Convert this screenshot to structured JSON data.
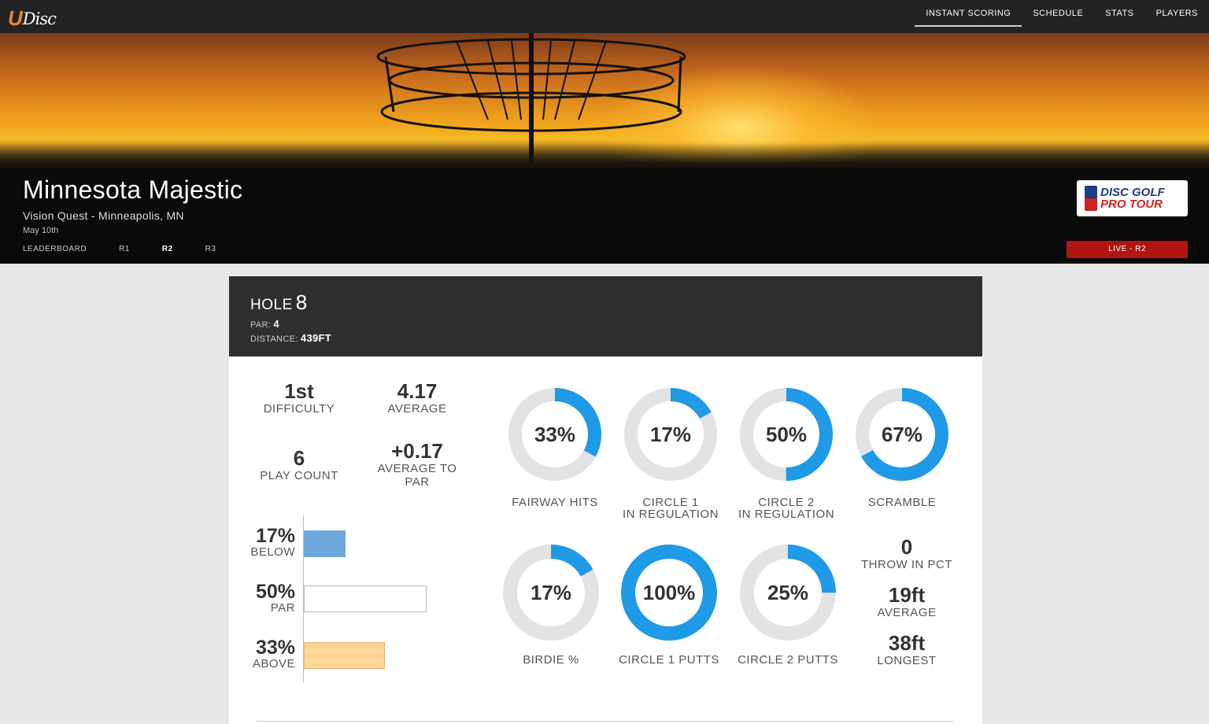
{
  "nav": {
    "logo_u": "U",
    "logo_text": "Disc",
    "links": [
      "INSTANT SCORING",
      "SCHEDULE",
      "STATS",
      "PLAYERS"
    ]
  },
  "event": {
    "title": "Minnesota Majestic",
    "subtitle": "Vision Quest - Minneapolis, MN",
    "date": "May 10th",
    "tabs": [
      "LEADERBOARD",
      "R1",
      "R2",
      "R3"
    ],
    "active_tab": "R2",
    "sponsor_line1": "DISC GOLF",
    "sponsor_line2": "PRO TOUR",
    "live_badge": "LIVE - R2"
  },
  "hole": {
    "label": "HOLE",
    "number": "8",
    "par_label": "PAR:",
    "par": "4",
    "distance_label": "DISTANCE:",
    "distance": "439FT"
  },
  "summary": {
    "difficulty_value": "1st",
    "difficulty_label": "DIFFICULTY",
    "average_value": "4.17",
    "average_label": "AVERAGE",
    "playcount_value": "6",
    "playcount_label": "PLAY COUNT",
    "avg_to_par_value": "+0.17",
    "avg_to_par_label_1": "AVERAGE TO",
    "avg_to_par_label_2": "PAR"
  },
  "score_dist": [
    {
      "pct": "17%",
      "label": "BELOW",
      "fraction": 0.17,
      "color": "#6fa8dc",
      "border": "#6fa8dc"
    },
    {
      "pct": "50%",
      "label": "PAR",
      "fraction": 0.5,
      "color": "#ffffff",
      "border": "#bbbbbb"
    },
    {
      "pct": "33%",
      "label": "ABOVE",
      "fraction": 0.33,
      "color": "#ffd59a",
      "border": "#e8b878"
    }
  ],
  "donuts": [
    {
      "pct": "33%",
      "value": 0.33,
      "label1": "FAIRWAY HITS",
      "label2": ""
    },
    {
      "pct": "17%",
      "value": 0.17,
      "label1": "CIRCLE 1",
      "label2": "IN REGULATION"
    },
    {
      "pct": "50%",
      "value": 0.5,
      "label1": "CIRCLE 2",
      "label2": "IN REGULATION"
    },
    {
      "pct": "67%",
      "value": 0.67,
      "label1": "SCRAMBLE",
      "label2": ""
    },
    {
      "pct": "17%",
      "value": 0.17,
      "label1": "BIRDIE %",
      "label2": ""
    },
    {
      "pct": "100%",
      "value": 1.0,
      "label1": "CIRCLE 1 PUTTS",
      "label2": ""
    },
    {
      "pct": "25%",
      "value": 0.25,
      "label1": "CIRCLE 2 PUTTS",
      "label2": ""
    }
  ],
  "throw_in": {
    "pct_value": "0",
    "pct_label": "THROW IN PCT",
    "avg_value": "19ft",
    "avg_label": "AVERAGE",
    "longest_value": "38ft",
    "longest_label": "LONGEST"
  },
  "colors": {
    "accent_blue": "#1f9ae6",
    "ring_gray": "#e3e3e3",
    "live_red": "#b0150f"
  }
}
